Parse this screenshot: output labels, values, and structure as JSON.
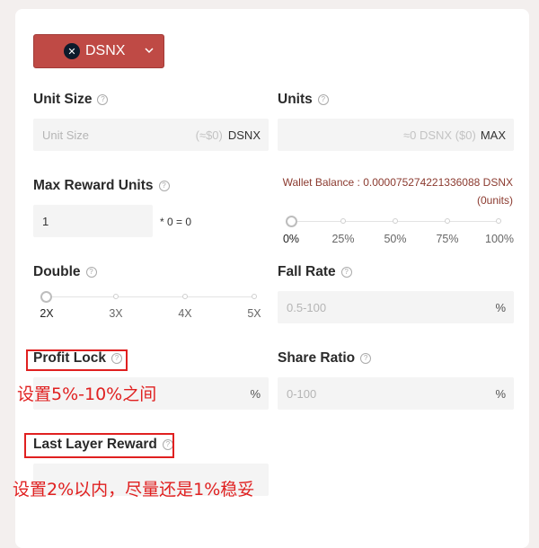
{
  "token": {
    "name": "DSNX",
    "logo_glyph": "✕"
  },
  "unit_size": {
    "label": "Unit Size",
    "placeholder": "Unit Size",
    "approx": "(≈$0)",
    "suffix": "DSNX"
  },
  "units": {
    "label": "Units",
    "value": "≈0 DSNX ($0)",
    "max_label": "MAX"
  },
  "max_reward_units": {
    "label": "Max Reward Units",
    "value": "1",
    "formula": "* 0 = 0"
  },
  "wallet": {
    "balance": "Wallet Balance : 0.000075274221336088 DSNX",
    "units": "(0units)"
  },
  "percent_slider": {
    "ticks": [
      "0%",
      "25%",
      "50%",
      "75%",
      "100%"
    ],
    "selected": "0%"
  },
  "double": {
    "label": "Double",
    "ticks": [
      "2X",
      "3X",
      "4X",
      "5X"
    ],
    "selected": "2X"
  },
  "fall_rate": {
    "label": "Fall Rate",
    "placeholder": "0.5-100",
    "unit": "%"
  },
  "profit_lock": {
    "label": "Profit Lock",
    "unit": "%",
    "annotation": "设置5%-10%之间"
  },
  "share_ratio": {
    "label": "Share Ratio",
    "placeholder": "0-100",
    "unit": "%"
  },
  "last_layer_reward": {
    "label": "Last Layer Reward",
    "annotation": "设置2%以内，尽量还是1%稳妥"
  },
  "colors": {
    "accent": "#bf4a45",
    "annotation": "#e02020",
    "wallet_text": "#8b3a2f"
  }
}
